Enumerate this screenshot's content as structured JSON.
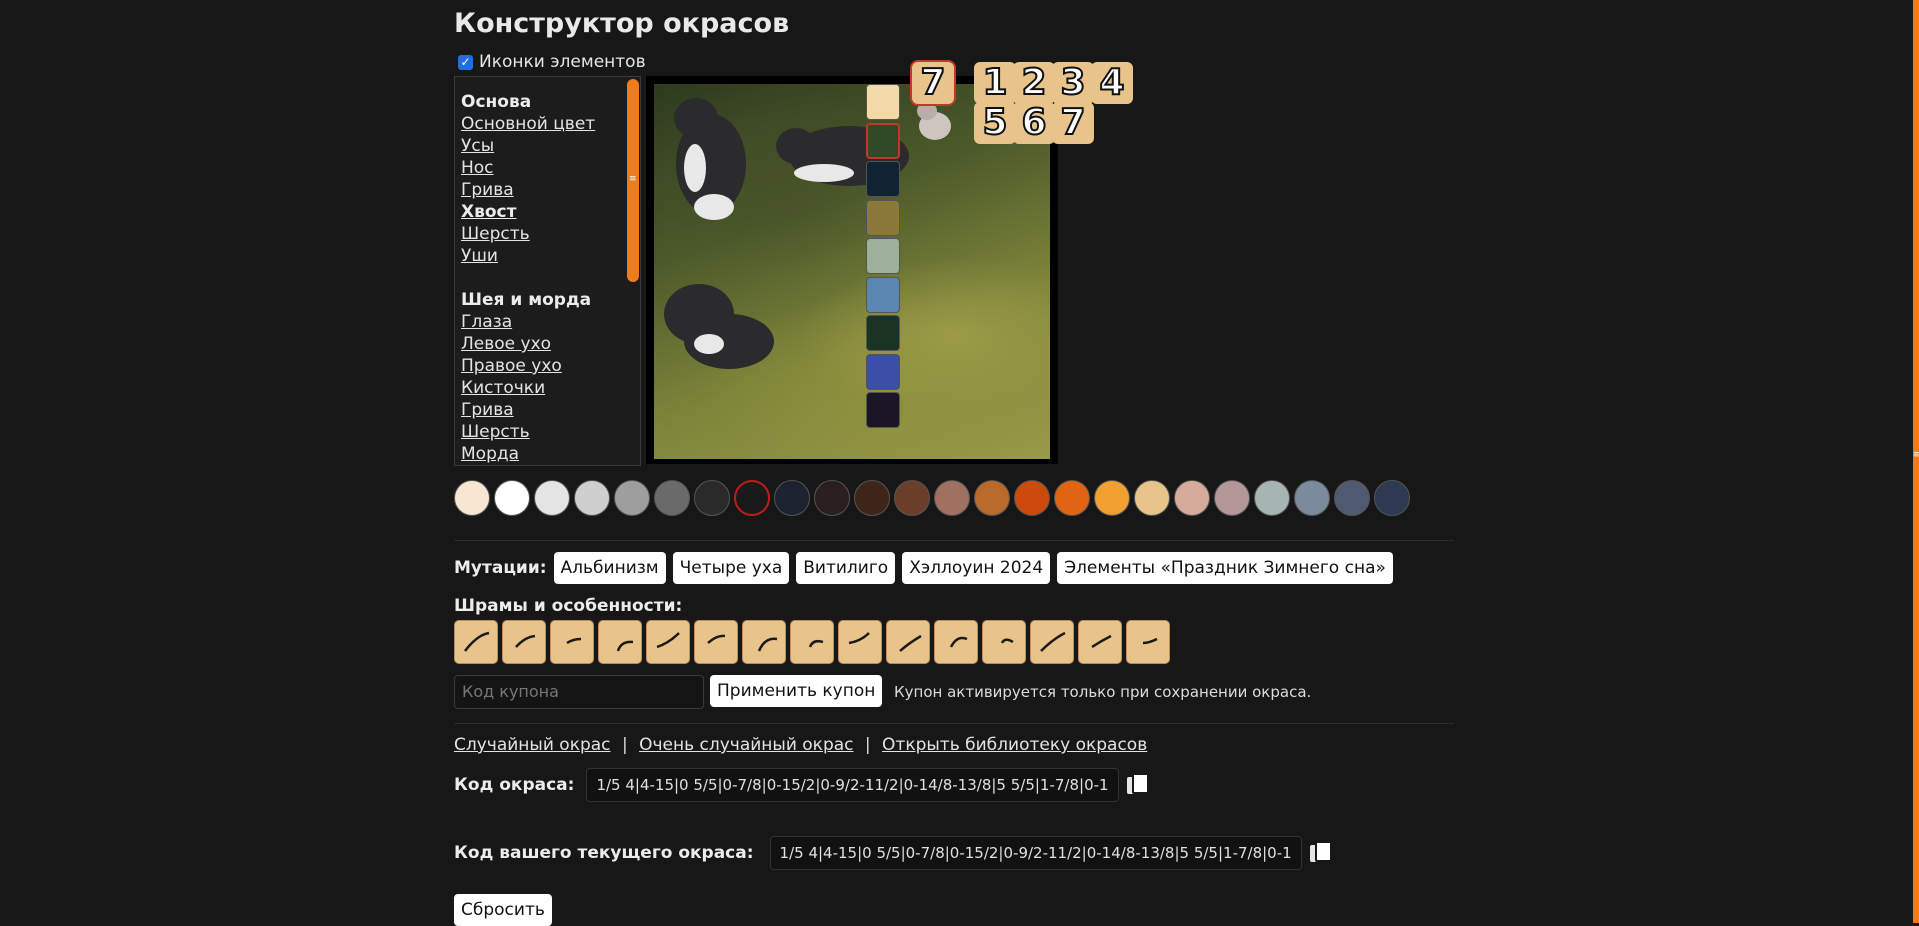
{
  "page": {
    "title": "Конструктор окрасов"
  },
  "icons_toggle": {
    "label": "Иконки элементов",
    "checked": true
  },
  "menu": {
    "group1": "Основа",
    "group1_items": [
      "Основной цвет",
      "Усы",
      "Нос",
      "Грива",
      "Хвост",
      "Шерсть",
      "Уши"
    ],
    "selected_item": "Хвост",
    "group2": "Шея и морда",
    "group2_items": [
      "Глаза",
      "Левое ухо",
      "Правое ухо",
      "Кисточки",
      "Грива",
      "Шерсть",
      "Морда"
    ]
  },
  "backgrounds": [
    {
      "name": "bg-plain",
      "color": "#f4d9a8"
    },
    {
      "name": "bg-forest",
      "color": "#2f4a24",
      "selected": true
    },
    {
      "name": "bg-night-forest",
      "color": "#0f2330"
    },
    {
      "name": "bg-autumn",
      "color": "#8a7a3a"
    },
    {
      "name": "bg-meadow",
      "color": "#9fb09a"
    },
    {
      "name": "bg-water",
      "color": "#5b86b0"
    },
    {
      "name": "bg-dark-forest",
      "color": "#1b3322"
    },
    {
      "name": "bg-ocean",
      "color": "#3b4ea8"
    },
    {
      "name": "bg-cave",
      "color": "#1a1626"
    }
  ],
  "slot_current": "7",
  "slots": [
    "1",
    "2",
    "3",
    "4",
    "5",
    "6",
    "7"
  ],
  "swatches": [
    "#f6e6d2",
    "#ffffff",
    "#e4e4e4",
    "#cfcfcf",
    "#9e9e9e",
    "#6a6a6a",
    "#2a2a2a",
    "#1a1a1a",
    "#1c2230",
    "#2a1e1e",
    "#3f2418",
    "#6b3e2a",
    "#a07060",
    "#b9692a",
    "#cc4a0c",
    "#e06412",
    "#efa030",
    "#e8c48a",
    "#d6ab9c",
    "#b39898",
    "#a6b4b2",
    "#7b8a9c",
    "#4f5a70",
    "#2e3a52"
  ],
  "selected_swatch_index": 7,
  "mutations": {
    "label": "Мутации:",
    "items": [
      "Альбинизм",
      "Четыре уха",
      "Витилиго",
      "Хэллоуин 2024",
      "Элементы «Праздник Зимнего сна»"
    ]
  },
  "scars": {
    "label": "Шрамы и особенности:",
    "count_shown": 15
  },
  "coupon": {
    "placeholder": "Код купона",
    "button": "Применить купон",
    "note": "Купон активируется только при сохранении окраса."
  },
  "links": {
    "random": "Случайный окрас",
    "very_random": "Очень случайный окрас",
    "library": "Открыть библиотеку окрасов",
    "sep": "|"
  },
  "codes": {
    "code_label": "Код окраса:",
    "code_value": "1/5 4|4-15|0 5/5|0-7/8|0-15/2|0-9/2-11/2|0-14/8-13/8|5 5/5|1-7/8|0-1",
    "current_label": "Код вашего текущего окраса:",
    "current_value": "1/5 4|4-15|0 5/5|0-7/8|0-15/2|0-9/2-11/2|0-14/8-13/8|5 5/5|1-7/8|0-1"
  },
  "reset_button": "Сбросить"
}
